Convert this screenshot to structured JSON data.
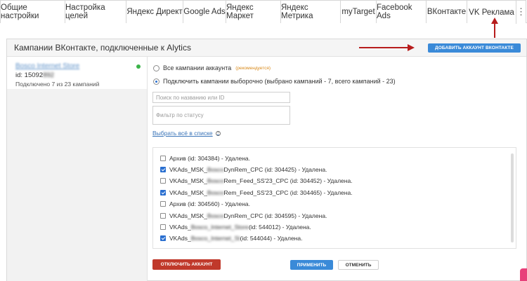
{
  "tabs": [
    {
      "label": "Общие настройки"
    },
    {
      "label": "Настройка целей"
    },
    {
      "label": "Яндекс Директ"
    },
    {
      "label": "Google Ads"
    },
    {
      "label": "Яндекс Маркет"
    },
    {
      "label": "Яндекс Метрика"
    },
    {
      "label": "myTarget"
    },
    {
      "label": "Facebook Ads"
    },
    {
      "label": "ВКонтакте"
    },
    {
      "label": "VK Реклама"
    }
  ],
  "more_glyph": "⋮",
  "panel": {
    "title": "Кампании ВКонтакте, подключенные к Alytics",
    "add_button": "ДОБАВИТЬ АККАУНТ ВКОНТАКТЕ"
  },
  "account": {
    "name": "Bosco Internet Store",
    "id_label": "id: 15092",
    "id_hidden": "892",
    "connected": "Подключено 7 из 23 кампаний",
    "status_color": "#3bb34a"
  },
  "options": {
    "all": "Все кампании аккаунта",
    "all_hint": "(рекомендуется)",
    "selected": "Подключить кампании выборочно (выбрано кампаний - 7, всего кампаний - 23)"
  },
  "search": {
    "placeholder": "Поиск по названию или ID"
  },
  "status_filter": {
    "placeholder": "Фильтр по статусу"
  },
  "select_all": {
    "label": "Выбрать всё в списке",
    "help": "?"
  },
  "campaigns": [
    {
      "checked": false,
      "pre": "Архив (id: 304384) - Удалена.",
      "blur": "",
      "post": ""
    },
    {
      "checked": true,
      "pre": "VKAds_MSK_",
      "blur": "Bosco",
      "post": "DynRem_CPC (id: 304425) - Удалена."
    },
    {
      "checked": false,
      "pre": "VKAds_MSK_",
      "blur": "Bosco",
      "post": "Rem_Feed_SS'23_CPC (id: 304452) - Удалена."
    },
    {
      "checked": true,
      "pre": "VKAds_MSK_",
      "blur": "Bosco",
      "post": "Rem_Feed_SS'23_CPC (id: 304465) - Удалена."
    },
    {
      "checked": false,
      "pre": "Архив (id: 304560) - Удалена.",
      "blur": "",
      "post": ""
    },
    {
      "checked": false,
      "pre": "VKAds_MSK_",
      "blur": "Bosco",
      "post": "DynRem_CPC (id: 304595) - Удалена."
    },
    {
      "checked": false,
      "pre": "VKAds_",
      "blur": "Bosco_Internet_Store",
      "post": "(id: 544012) - Удалена."
    },
    {
      "checked": true,
      "pre": "VKAds_",
      "blur": "Bosco_Internet_St",
      "post": "(id: 544044) - Удалена."
    }
  ],
  "buttons": {
    "disconnect": "ОТКЛЮЧИТЬ АККАУНТ",
    "apply": "ПРИМЕНИТЬ",
    "cancel": "ОТМЕНИТЬ"
  },
  "colors": {
    "accent": "#3a8ad8",
    "danger": "#c0392b",
    "hint": "#d98a1b"
  }
}
